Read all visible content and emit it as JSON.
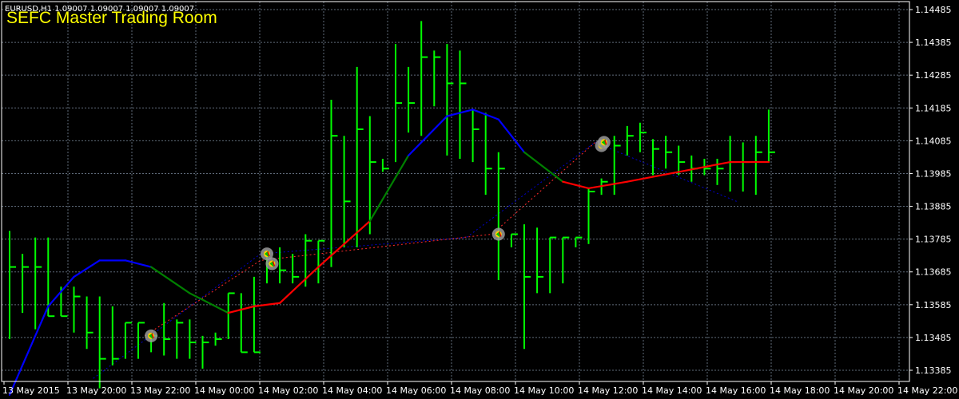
{
  "window": {
    "symbol_line": "EURUSD,H1  1.09007 1.09007 1.09007 1.09007",
    "title": "SEFC Master Trading Room"
  },
  "colors": {
    "background": "#000000",
    "grid": "#5f6b7a",
    "axis": "#ffffff",
    "bar": "#00ff00",
    "ma_up": "#0000ff",
    "ma_flat": "#008000",
    "ma_down": "#ff0000",
    "signal_line": "#ff2a2a",
    "projection_line": "#0000cc",
    "title": "#ffff00"
  },
  "chart_data": {
    "type": "bar",
    "style": "HLC bars (close tick on right)",
    "price_axis": {
      "ticks": [
        "1.14485",
        "1.14385",
        "1.14285",
        "1.14185",
        "1.14085",
        "1.13985",
        "1.13885",
        "1.13785",
        "1.13685",
        "1.13585",
        "1.13485",
        "1.13385"
      ],
      "ylim": [
        1.13385,
        1.14485
      ]
    },
    "time_axis": {
      "ticks": [
        "13 May 2015",
        "13 May 20:00",
        "13 May 22:00",
        "14 May 00:00",
        "14 May 02:00",
        "14 May 04:00",
        "14 May 06:00",
        "14 May 08:00",
        "14 May 10:00",
        "14 May 12:00",
        "14 May 14:00",
        "14 May 16:00",
        "14 May 18:00",
        "14 May 20:00",
        "14 May 22:00"
      ]
    },
    "grid": true,
    "bars": [
      {
        "h": 1.1381,
        "l": 1.1348,
        "c": 1.137
      },
      {
        "h": 1.1374,
        "l": 1.1356,
        "c": 1.137
      },
      {
        "h": 1.1379,
        "l": 1.1351,
        "c": 1.137
      },
      {
        "h": 1.1379,
        "l": 1.1355,
        "c": 1.1355
      },
      {
        "h": 1.1364,
        "l": 1.1355,
        "c": 1.1355
      },
      {
        "h": 1.1364,
        "l": 1.135,
        "c": 1.1361
      },
      {
        "h": 1.1361,
        "l": 1.1345,
        "c": 1.135
      },
      {
        "h": 1.1361,
        "l": 1.1333,
        "c": 1.1342
      },
      {
        "h": 1.1358,
        "l": 1.134,
        "c": 1.1342
      },
      {
        "h": 1.1353,
        "l": 1.1342,
        "c": 1.1353
      },
      {
        "h": 1.1353,
        "l": 1.1342,
        "c": 1.1353
      },
      {
        "h": 1.1349,
        "l": 1.1344,
        "c": 1.1349
      },
      {
        "h": 1.1359,
        "l": 1.1343,
        "c": 1.1348
      },
      {
        "h": 1.1354,
        "l": 1.1342,
        "c": 1.1353
      },
      {
        "h": 1.1354,
        "l": 1.1342,
        "c": 1.1347
      },
      {
        "h": 1.1349,
        "l": 1.1339,
        "c": 1.1347
      },
      {
        "h": 1.135,
        "l": 1.1346,
        "c": 1.1348
      },
      {
        "h": 1.1362,
        "l": 1.1348,
        "c": 1.1362
      },
      {
        "h": 1.1362,
        "l": 1.1344,
        "c": 1.1344
      },
      {
        "h": 1.1367,
        "l": 1.1344,
        "c": 1.1344
      },
      {
        "h": 1.1374,
        "l": 1.1365,
        "c": 1.1371
      },
      {
        "h": 1.1376,
        "l": 1.1365,
        "c": 1.1369
      },
      {
        "h": 1.1374,
        "l": 1.1365,
        "c": 1.1367
      },
      {
        "h": 1.138,
        "l": 1.1364,
        "c": 1.1378
      },
      {
        "h": 1.1378,
        "l": 1.1365,
        "c": 1.1378
      },
      {
        "h": 1.1421,
        "l": 1.137,
        "c": 1.141
      },
      {
        "h": 1.141,
        "l": 1.1376,
        "c": 1.139
      },
      {
        "h": 1.1431,
        "l": 1.1376,
        "c": 1.1412
      },
      {
        "h": 1.1416,
        "l": 1.138,
        "c": 1.1402
      },
      {
        "h": 1.1403,
        "l": 1.1399,
        "c": 1.14
      },
      {
        "h": 1.1438,
        "l": 1.1402,
        "c": 1.142
      },
      {
        "h": 1.1431,
        "l": 1.1411,
        "c": 1.142
      },
      {
        "h": 1.1445,
        "l": 1.141,
        "c": 1.1434
      },
      {
        "h": 1.1436,
        "l": 1.1419,
        "c": 1.1434
      },
      {
        "h": 1.1438,
        "l": 1.1404,
        "c": 1.1426
      },
      {
        "h": 1.1436,
        "l": 1.1403,
        "c": 1.1426
      },
      {
        "h": 1.1418,
        "l": 1.1402,
        "c": 1.1412
      },
      {
        "h": 1.1417,
        "l": 1.1392,
        "c": 1.14
      },
      {
        "h": 1.1405,
        "l": 1.1366,
        "c": 1.14
      },
      {
        "h": 1.138,
        "l": 1.1376,
        "c": 1.138
      },
      {
        "h": 1.1383,
        "l": 1.1345,
        "c": 1.1367
      },
      {
        "h": 1.1382,
        "l": 1.1362,
        "c": 1.1367
      },
      {
        "h": 1.1379,
        "l": 1.1362,
        "c": 1.1379
      },
      {
        "h": 1.1379,
        "l": 1.1365,
        "c": 1.1379
      },
      {
        "h": 1.1379,
        "l": 1.1376,
        "c": 1.1379
      },
      {
        "h": 1.1394,
        "l": 1.1377,
        "c": 1.1393
      },
      {
        "h": 1.1397,
        "l": 1.1392,
        "c": 1.1396
      },
      {
        "h": 1.141,
        "l": 1.1392,
        "c": 1.1407
      },
      {
        "h": 1.1413,
        "l": 1.1404,
        "c": 1.141
      },
      {
        "h": 1.1414,
        "l": 1.1405,
        "c": 1.1411
      },
      {
        "h": 1.1409,
        "l": 1.1398,
        "c": 1.1406
      },
      {
        "h": 1.141,
        "l": 1.14,
        "c": 1.1405
      },
      {
        "h": 1.1407,
        "l": 1.1398,
        "c": 1.1402
      },
      {
        "h": 1.1404,
        "l": 1.1396,
        "c": 1.14
      },
      {
        "h": 1.1403,
        "l": 1.1398,
        "c": 1.14
      },
      {
        "h": 1.1403,
        "l": 1.1395,
        "c": 1.14
      },
      {
        "h": 1.141,
        "l": 1.1393,
        "c": 1.1402
      },
      {
        "h": 1.1408,
        "l": 1.1393,
        "c": 1.1402
      },
      {
        "h": 1.141,
        "l": 1.1392,
        "c": 1.1405
      },
      {
        "h": 1.1418,
        "l": 1.1402,
        "c": 1.1405
      }
    ],
    "moving_average": [
      {
        "x": 0,
        "y": 1.1331
      },
      {
        "x": 3,
        "y": 1.1358
      },
      {
        "x": 5,
        "y": 1.1367
      },
      {
        "x": 7,
        "y": 1.1372
      },
      {
        "x": 9,
        "y": 1.1372
      },
      {
        "x": 11,
        "y": 1.137
      },
      {
        "x": 14,
        "y": 1.1362
      },
      {
        "x": 17,
        "y": 1.1356
      },
      {
        "x": 19,
        "y": 1.1358
      },
      {
        "x": 21,
        "y": 1.1359
      },
      {
        "x": 24,
        "y": 1.137
      },
      {
        "x": 28,
        "y": 1.1384
      },
      {
        "x": 31,
        "y": 1.1404
      },
      {
        "x": 34,
        "y": 1.1416
      },
      {
        "x": 36,
        "y": 1.1418
      },
      {
        "x": 38,
        "y": 1.1415
      },
      {
        "x": 40,
        "y": 1.1405
      },
      {
        "x": 43,
        "y": 1.1396
      },
      {
        "x": 45,
        "y": 1.1394
      },
      {
        "x": 48,
        "y": 1.1396
      },
      {
        "x": 52,
        "y": 1.1399
      },
      {
        "x": 56,
        "y": 1.1402
      },
      {
        "x": 59,
        "y": 1.1402
      }
    ],
    "ma_segments": [
      {
        "from": 0,
        "to": 5,
        "trend": "up"
      },
      {
        "from": 5,
        "to": 7,
        "trend": "flat"
      },
      {
        "from": 7,
        "to": 11,
        "trend": "down"
      },
      {
        "from": 11,
        "to": 12,
        "trend": "flat"
      },
      {
        "from": 12,
        "to": 16,
        "trend": "up"
      },
      {
        "from": 16,
        "to": 17,
        "trend": "flat"
      },
      {
        "from": 17,
        "to": 22,
        "trend": "down"
      }
    ],
    "signals": [
      {
        "bar": 11,
        "price": 1.1349
      },
      {
        "bar": 20,
        "price": 1.1374
      },
      {
        "bar": 20.4,
        "price": 1.1371
      },
      {
        "bar": 38,
        "price": 1.138
      },
      {
        "bar": 46,
        "price": 1.1407
      },
      {
        "bar": 46.2,
        "price": 1.1408
      }
    ],
    "signal_path": [
      {
        "x": 11,
        "y": 1.1349
      },
      {
        "x": 20,
        "y": 1.1372
      },
      {
        "x": 38,
        "y": 1.138
      },
      {
        "x": 46,
        "y": 1.1408
      }
    ],
    "projection": [
      {
        "x": 7,
        "y": 1.1336
      },
      {
        "x": 20,
        "y": 1.1374
      },
      {
        "x": 36,
        "y": 1.1379
      },
      {
        "x": 46,
        "y": 1.1408
      },
      {
        "x": 57,
        "y": 1.139
      }
    ]
  }
}
